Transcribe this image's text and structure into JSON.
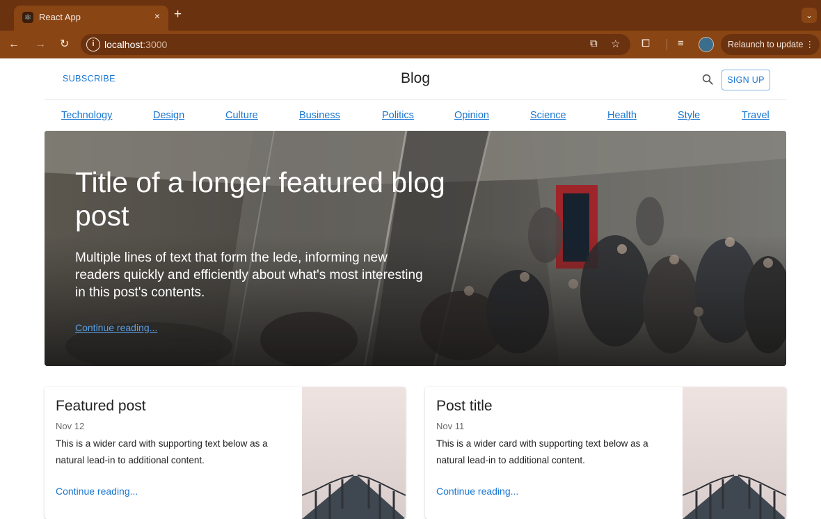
{
  "browser": {
    "tab_title": "React App",
    "tab_close": "×",
    "new_tab": "+",
    "url_host": "localhost",
    "url_port": ":3000",
    "relaunch_label": "Relaunch to update",
    "relaunch_menu": "⋮",
    "tab_search": "⌄"
  },
  "header": {
    "subscribe_label": "SUBSCRIBE",
    "brand": "Blog",
    "signup_label": "SIGN UP"
  },
  "nav": {
    "sections": [
      "Technology",
      "Design",
      "Culture",
      "Business",
      "Politics",
      "Opinion",
      "Science",
      "Health",
      "Style",
      "Travel"
    ]
  },
  "hero": {
    "title": "Title of a longer featured blog post",
    "lede": "Multiple lines of text that form the lede, informing new readers quickly and efficiently about what's most interesting in this post's contents.",
    "link": "Continue reading..."
  },
  "cards": [
    {
      "title": "Featured post",
      "date": "Nov 12",
      "text": "This is a wider card with supporting text below as a natural lead-in to additional content.",
      "link": "Continue reading..."
    },
    {
      "title": "Post title",
      "date": "Nov 11",
      "text": "This is a wider card with supporting text below as a natural lead-in to additional content.",
      "link": "Continue reading..."
    }
  ],
  "colors": {
    "link": "#1976d2",
    "chrome_tabbar": "#6b3210",
    "chrome_toolbar": "#8a4514"
  }
}
